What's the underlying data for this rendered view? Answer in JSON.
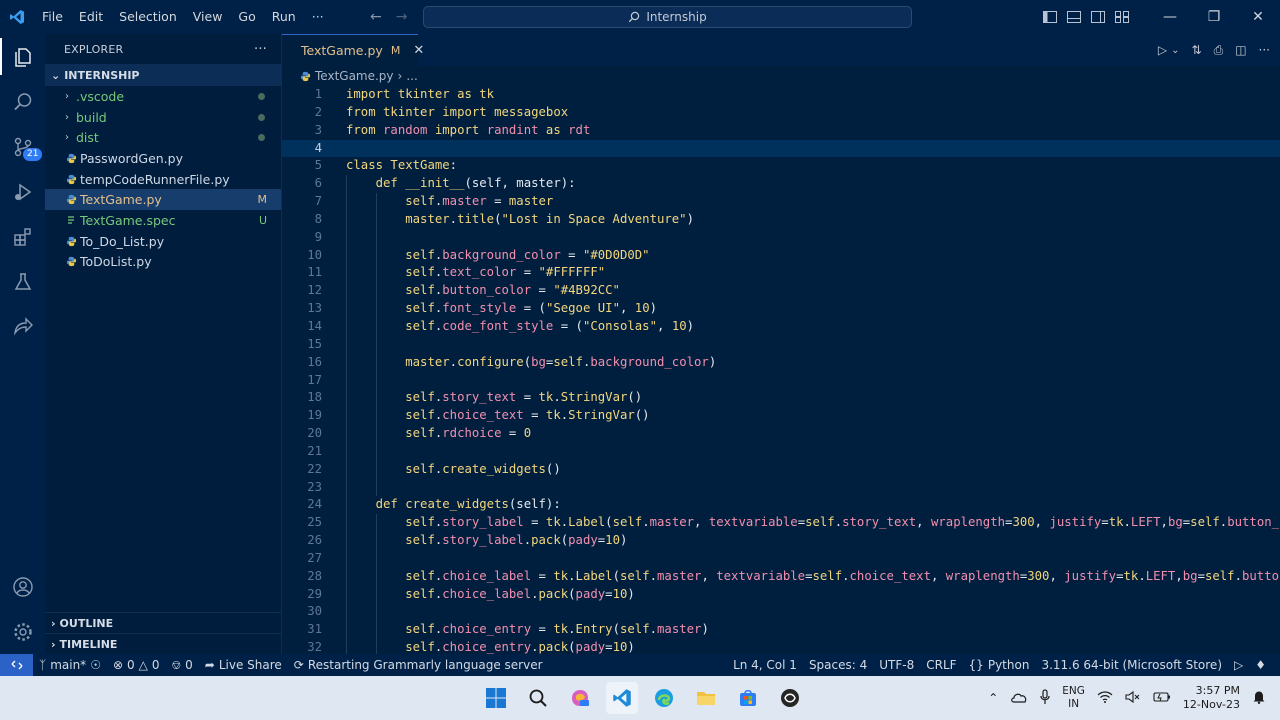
{
  "titlebar": {
    "menu": [
      "File",
      "Edit",
      "Selection",
      "View",
      "Go",
      "Run",
      "···"
    ],
    "search_text": "Internship"
  },
  "activity": {
    "source_control_badge": "21"
  },
  "sidebar": {
    "title": "EXPLORER",
    "more": "···",
    "project": "INTERNSHIP",
    "items": [
      {
        "label": ".vscode",
        "folder": true,
        "color": "#77c97a",
        "tag": ""
      },
      {
        "label": "build",
        "folder": true,
        "color": "#77c97a",
        "tag": ""
      },
      {
        "label": "dist",
        "folder": true,
        "color": "#77c97a",
        "tag": ""
      },
      {
        "label": "PasswordGen.py",
        "folder": false,
        "color": "#cfd8e6",
        "tag": ""
      },
      {
        "label": "tempCodeRunnerFile.py",
        "folder": false,
        "color": "#cfd8e6",
        "tag": ""
      },
      {
        "label": "TextGame.py",
        "folder": false,
        "color": "#e2c08d",
        "tag": "M"
      },
      {
        "label": "TextGame.spec",
        "folder": false,
        "color": "#77c97a",
        "tag": "U"
      },
      {
        "label": "To_Do_List.py",
        "folder": false,
        "color": "#cfd8e6",
        "tag": ""
      },
      {
        "label": "ToDoList.py",
        "folder": false,
        "color": "#cfd8e6",
        "tag": ""
      }
    ],
    "outline": "OUTLINE",
    "timeline": "TIMELINE"
  },
  "editor": {
    "tab_label": "TextGame.py",
    "tab_modified": "M",
    "breadcrumb_file": "TextGame.py",
    "breadcrumb_rest": "...",
    "current_line": 4,
    "lines": [
      [
        [
          "kw",
          "import "
        ],
        [
          "mod-n",
          "tkinter "
        ],
        [
          "kw",
          "as "
        ],
        [
          "mod-n",
          "tk"
        ]
      ],
      [
        [
          "kw",
          "from "
        ],
        [
          "mod-n",
          "tkinter "
        ],
        [
          "kw",
          "import "
        ],
        [
          "mod-n",
          "messagebox"
        ]
      ],
      [
        [
          "kw",
          "from "
        ],
        [
          "prop",
          "random "
        ],
        [
          "kw",
          "import "
        ],
        [
          "prop",
          "randint "
        ],
        [
          "kw",
          "as "
        ],
        [
          "prop",
          "rdt"
        ]
      ],
      [],
      [
        [
          "kw",
          "class "
        ],
        [
          "mod-n",
          "TextGame"
        ],
        [
          "txt",
          ":"
        ]
      ],
      [
        [
          "txt",
          "    "
        ],
        [
          "kw",
          "def "
        ],
        [
          "fn",
          "__init__"
        ],
        [
          "txt",
          "(self, master):"
        ]
      ],
      [
        [
          "txt",
          "        "
        ],
        [
          "kw",
          "self"
        ],
        [
          "txt",
          "."
        ],
        [
          "prop",
          "master"
        ],
        [
          "txt",
          " = "
        ],
        [
          "kw",
          "master"
        ]
      ],
      [
        [
          "txt",
          "        "
        ],
        [
          "kw",
          "master"
        ],
        [
          "txt",
          "."
        ],
        [
          "fn",
          "title"
        ],
        [
          "txt",
          "("
        ],
        [
          "str",
          "\"Lost in Space Adventure\""
        ],
        [
          "txt",
          ")"
        ]
      ],
      [],
      [
        [
          "txt",
          "        "
        ],
        [
          "kw",
          "self"
        ],
        [
          "txt",
          "."
        ],
        [
          "prop",
          "background_color"
        ],
        [
          "txt",
          " = "
        ],
        [
          "str",
          "\"#0D0D0D\""
        ]
      ],
      [
        [
          "txt",
          "        "
        ],
        [
          "kw",
          "self"
        ],
        [
          "txt",
          "."
        ],
        [
          "prop",
          "text_color"
        ],
        [
          "txt",
          " = "
        ],
        [
          "str",
          "\"#FFFFFF\""
        ]
      ],
      [
        [
          "txt",
          "        "
        ],
        [
          "kw",
          "self"
        ],
        [
          "txt",
          "."
        ],
        [
          "prop",
          "button_color"
        ],
        [
          "txt",
          " = "
        ],
        [
          "str",
          "\"#4B92CC\""
        ]
      ],
      [
        [
          "txt",
          "        "
        ],
        [
          "kw",
          "self"
        ],
        [
          "txt",
          "."
        ],
        [
          "prop",
          "font_style"
        ],
        [
          "txt",
          " = ("
        ],
        [
          "str",
          "\"Segoe UI\""
        ],
        [
          "txt",
          ", "
        ],
        [
          "num",
          "10"
        ],
        [
          "txt",
          ")"
        ]
      ],
      [
        [
          "txt",
          "        "
        ],
        [
          "kw",
          "self"
        ],
        [
          "txt",
          "."
        ],
        [
          "prop",
          "code_font_style"
        ],
        [
          "txt",
          " = ("
        ],
        [
          "str",
          "\"Consolas\""
        ],
        [
          "txt",
          ", "
        ],
        [
          "num",
          "10"
        ],
        [
          "txt",
          ")"
        ]
      ],
      [],
      [
        [
          "txt",
          "        "
        ],
        [
          "kw",
          "master"
        ],
        [
          "txt",
          "."
        ],
        [
          "fn",
          "configure"
        ],
        [
          "txt",
          "("
        ],
        [
          "prop",
          "bg"
        ],
        [
          "txt",
          "="
        ],
        [
          "kw",
          "self"
        ],
        [
          "txt",
          "."
        ],
        [
          "prop",
          "background_color"
        ],
        [
          "txt",
          ")"
        ]
      ],
      [],
      [
        [
          "txt",
          "        "
        ],
        [
          "kw",
          "self"
        ],
        [
          "txt",
          "."
        ],
        [
          "prop",
          "story_text"
        ],
        [
          "txt",
          " = "
        ],
        [
          "kw",
          "tk"
        ],
        [
          "txt",
          "."
        ],
        [
          "fn",
          "StringVar"
        ],
        [
          "txt",
          "()"
        ]
      ],
      [
        [
          "txt",
          "        "
        ],
        [
          "kw",
          "self"
        ],
        [
          "txt",
          "."
        ],
        [
          "prop",
          "choice_text"
        ],
        [
          "txt",
          " = "
        ],
        [
          "kw",
          "tk"
        ],
        [
          "txt",
          "."
        ],
        [
          "fn",
          "StringVar"
        ],
        [
          "txt",
          "()"
        ]
      ],
      [
        [
          "txt",
          "        "
        ],
        [
          "kw",
          "self"
        ],
        [
          "txt",
          "."
        ],
        [
          "prop",
          "rdchoice"
        ],
        [
          "txt",
          " = "
        ],
        [
          "num",
          "0"
        ]
      ],
      [],
      [
        [
          "txt",
          "        "
        ],
        [
          "kw",
          "self"
        ],
        [
          "txt",
          "."
        ],
        [
          "fn",
          "create_widgets"
        ],
        [
          "txt",
          "()"
        ]
      ],
      [],
      [
        [
          "txt",
          "    "
        ],
        [
          "kw",
          "def "
        ],
        [
          "fn",
          "create_widgets"
        ],
        [
          "txt",
          "(self):"
        ]
      ],
      [
        [
          "txt",
          "        "
        ],
        [
          "kw",
          "self"
        ],
        [
          "txt",
          "."
        ],
        [
          "prop",
          "story_label"
        ],
        [
          "txt",
          " = "
        ],
        [
          "kw",
          "tk"
        ],
        [
          "txt",
          "."
        ],
        [
          "fn",
          "Label"
        ],
        [
          "txt",
          "("
        ],
        [
          "kw",
          "self"
        ],
        [
          "txt",
          "."
        ],
        [
          "prop",
          "master"
        ],
        [
          "txt",
          ", "
        ],
        [
          "prop",
          "textvariable"
        ],
        [
          "txt",
          "="
        ],
        [
          "kw",
          "self"
        ],
        [
          "txt",
          "."
        ],
        [
          "prop",
          "story_text"
        ],
        [
          "txt",
          ", "
        ],
        [
          "prop",
          "wraplength"
        ],
        [
          "txt",
          "="
        ],
        [
          "num",
          "300"
        ],
        [
          "txt",
          ", "
        ],
        [
          "prop",
          "justify"
        ],
        [
          "txt",
          "="
        ],
        [
          "kw",
          "tk"
        ],
        [
          "txt",
          "."
        ],
        [
          "prop",
          "LEFT"
        ],
        [
          "txt",
          ","
        ],
        [
          "prop",
          "bg"
        ],
        [
          "txt",
          "="
        ],
        [
          "kw",
          "self"
        ],
        [
          "txt",
          "."
        ],
        [
          "prop",
          "button_colo"
        ]
      ],
      [
        [
          "txt",
          "        "
        ],
        [
          "kw",
          "self"
        ],
        [
          "txt",
          "."
        ],
        [
          "prop",
          "story_label"
        ],
        [
          "txt",
          "."
        ],
        [
          "fn",
          "pack"
        ],
        [
          "txt",
          "("
        ],
        [
          "prop",
          "pady"
        ],
        [
          "txt",
          "="
        ],
        [
          "num",
          "10"
        ],
        [
          "txt",
          ")"
        ]
      ],
      [],
      [
        [
          "txt",
          "        "
        ],
        [
          "kw",
          "self"
        ],
        [
          "txt",
          "."
        ],
        [
          "prop",
          "choice_label"
        ],
        [
          "txt",
          " = "
        ],
        [
          "kw",
          "tk"
        ],
        [
          "txt",
          "."
        ],
        [
          "fn",
          "Label"
        ],
        [
          "txt",
          "("
        ],
        [
          "kw",
          "self"
        ],
        [
          "txt",
          "."
        ],
        [
          "prop",
          "master"
        ],
        [
          "txt",
          ", "
        ],
        [
          "prop",
          "textvariable"
        ],
        [
          "txt",
          "="
        ],
        [
          "kw",
          "self"
        ],
        [
          "txt",
          "."
        ],
        [
          "prop",
          "choice_text"
        ],
        [
          "txt",
          ", "
        ],
        [
          "prop",
          "wraplength"
        ],
        [
          "txt",
          "="
        ],
        [
          "num",
          "300"
        ],
        [
          "txt",
          ", "
        ],
        [
          "prop",
          "justify"
        ],
        [
          "txt",
          "="
        ],
        [
          "kw",
          "tk"
        ],
        [
          "txt",
          "."
        ],
        [
          "prop",
          "LEFT"
        ],
        [
          "txt",
          ","
        ],
        [
          "prop",
          "bg"
        ],
        [
          "txt",
          "="
        ],
        [
          "kw",
          "self"
        ],
        [
          "txt",
          "."
        ],
        [
          "prop",
          "button_co"
        ]
      ],
      [
        [
          "txt",
          "        "
        ],
        [
          "kw",
          "self"
        ],
        [
          "txt",
          "."
        ],
        [
          "prop",
          "choice_label"
        ],
        [
          "txt",
          "."
        ],
        [
          "fn",
          "pack"
        ],
        [
          "txt",
          "("
        ],
        [
          "prop",
          "pady"
        ],
        [
          "txt",
          "="
        ],
        [
          "num",
          "10"
        ],
        [
          "txt",
          ")"
        ]
      ],
      [],
      [
        [
          "txt",
          "        "
        ],
        [
          "kw",
          "self"
        ],
        [
          "txt",
          "."
        ],
        [
          "prop",
          "choice_entry"
        ],
        [
          "txt",
          " = "
        ],
        [
          "kw",
          "tk"
        ],
        [
          "txt",
          "."
        ],
        [
          "fn",
          "Entry"
        ],
        [
          "txt",
          "("
        ],
        [
          "kw",
          "self"
        ],
        [
          "txt",
          "."
        ],
        [
          "prop",
          "master"
        ],
        [
          "txt",
          ")"
        ]
      ],
      [
        [
          "txt",
          "        "
        ],
        [
          "kw",
          "self"
        ],
        [
          "txt",
          "."
        ],
        [
          "prop",
          "choice_entry"
        ],
        [
          "txt",
          "."
        ],
        [
          "fn",
          "pack"
        ],
        [
          "txt",
          "("
        ],
        [
          "prop",
          "pady"
        ],
        [
          "txt",
          "="
        ],
        [
          "num",
          "10"
        ],
        [
          "txt",
          ")"
        ]
      ]
    ]
  },
  "status": {
    "branch": "main*",
    "errors": "0",
    "warnings": "0",
    "ports": "0",
    "live_share": "Live Share",
    "message": "Restarting Grammarly language server",
    "position": "Ln 4, Col 1",
    "spaces": "Spaces: 4",
    "encoding": "UTF-8",
    "eol": "CRLF",
    "language_braces": "{}",
    "language": "Python",
    "interpreter": "3.11.6 64-bit (Microsoft Store)"
  },
  "taskbar": {
    "lang_top": "ENG",
    "lang_bottom": "IN",
    "time": "3:57 PM",
    "date": "12-Nov-23"
  },
  "colors": {
    "accent": "#2a62c8",
    "background": "#001f3f",
    "modified": "#e2c08d",
    "untracked": "#77c97a"
  }
}
